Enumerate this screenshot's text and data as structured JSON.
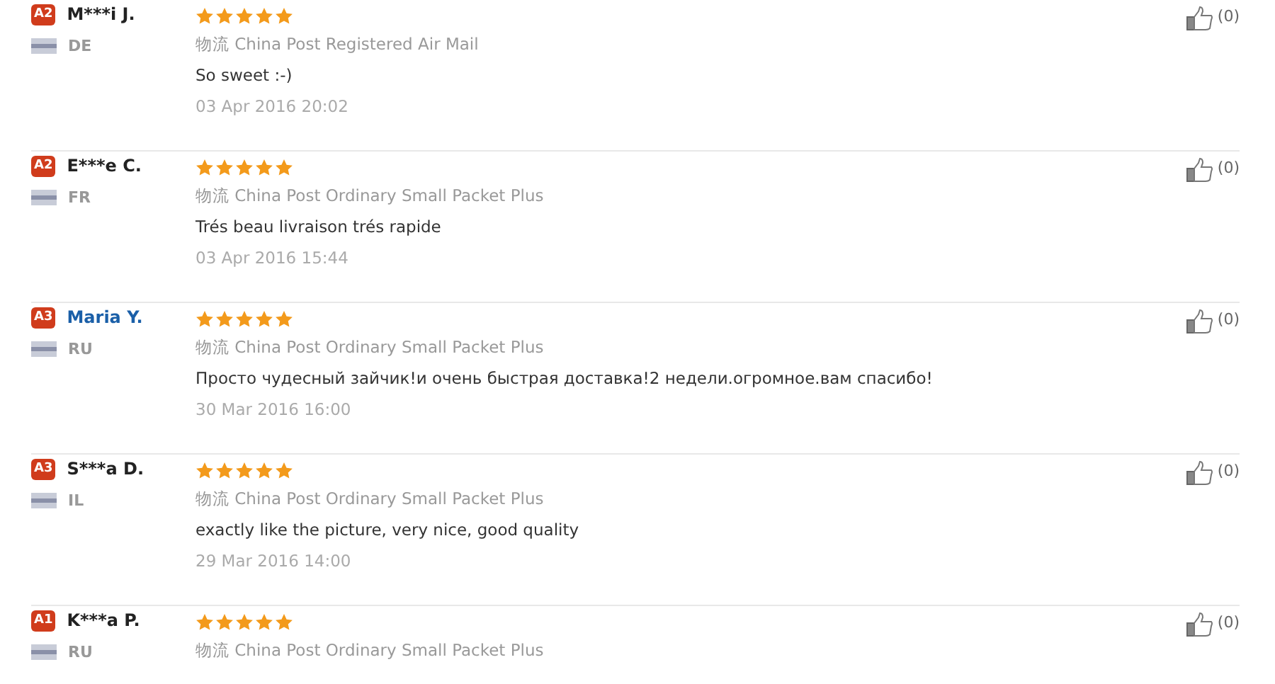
{
  "reviews": [
    {
      "badge": "A2",
      "name": "M***i J.",
      "color": "#222222",
      "country": "DE",
      "stars": 5,
      "shipping_label": "物流",
      "shipping": "China Post Registered Air Mail",
      "comment": "So sweet :-)",
      "date": "03 Apr 2016 20:02",
      "likes": "(0)"
    },
    {
      "badge": "A2",
      "name": "E***e C.",
      "color": "#222222",
      "country": "FR",
      "stars": 5,
      "shipping_label": "物流",
      "shipping": "China Post Ordinary Small Packet Plus",
      "comment": "Trés beau livraison trés rapide",
      "date": "03 Apr 2016 15:44",
      "likes": "(0)"
    },
    {
      "badge": "A3",
      "name": "Maria Y.",
      "color": "#1a5fa8",
      "country": "RU",
      "stars": 5,
      "shipping_label": "物流",
      "shipping": "China Post Ordinary Small Packet Plus",
      "comment": "Просто чудесный зайчик!и очень быстрая доставка!2 недели.огромное.вам спасибо!",
      "date": "30 Mar 2016 16:00",
      "likes": "(0)"
    },
    {
      "badge": "A3",
      "name": "S***a D.",
      "color": "#222222",
      "country": "IL",
      "stars": 5,
      "shipping_label": "物流",
      "shipping": "China Post Ordinary Small Packet Plus",
      "comment": "exactly like the picture, very nice, good quality",
      "date": "29 Mar 2016 14:00",
      "likes": "(0)"
    },
    {
      "badge": "A1",
      "name": "K***a P.",
      "color": "#222222",
      "country": "RU",
      "stars": 5,
      "shipping_label": "物流",
      "shipping": "China Post Ordinary Small Packet Plus",
      "likes": "(0)"
    }
  ]
}
